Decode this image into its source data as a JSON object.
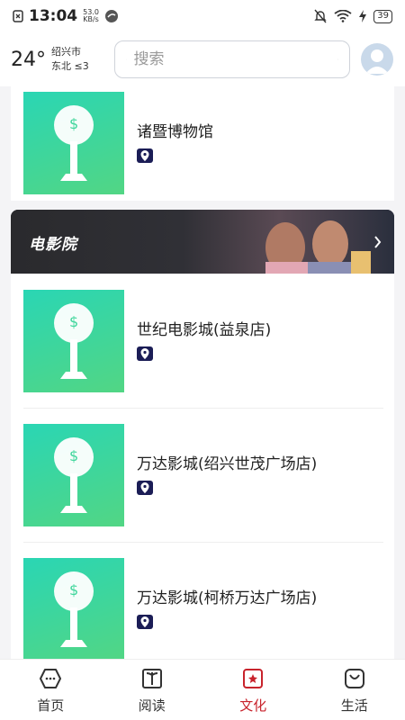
{
  "status_bar": {
    "time": "13:04",
    "speed_value": "53.0",
    "speed_unit": "KB/s",
    "battery": "39"
  },
  "header": {
    "temperature": "24°",
    "city": "绍兴市",
    "wind": "东北 ≤3",
    "search_placeholder": "搜索"
  },
  "list_top": {
    "items": [
      {
        "title": "诸暨博物馆"
      }
    ]
  },
  "banner": {
    "title": "电影院"
  },
  "cinemas": {
    "items": [
      {
        "title": "世纪电影城(益泉店)"
      },
      {
        "title": "万达影城(绍兴世茂广场店)"
      },
      {
        "title": "万达影城(柯桥万达广场店)"
      }
    ]
  },
  "tabs": [
    {
      "label": "首页",
      "icon": "home-icon",
      "active": false
    },
    {
      "label": "阅读",
      "icon": "book-icon",
      "active": false
    },
    {
      "label": "文化",
      "icon": "culture-icon",
      "active": true
    },
    {
      "label": "生活",
      "icon": "life-bag-icon",
      "active": false
    }
  ],
  "colors": {
    "accent": "#c8232c",
    "thumb_gradient_start": "#2ad6b4",
    "thumb_gradient_end": "#52d684",
    "location_badge": "#1b1d56"
  }
}
